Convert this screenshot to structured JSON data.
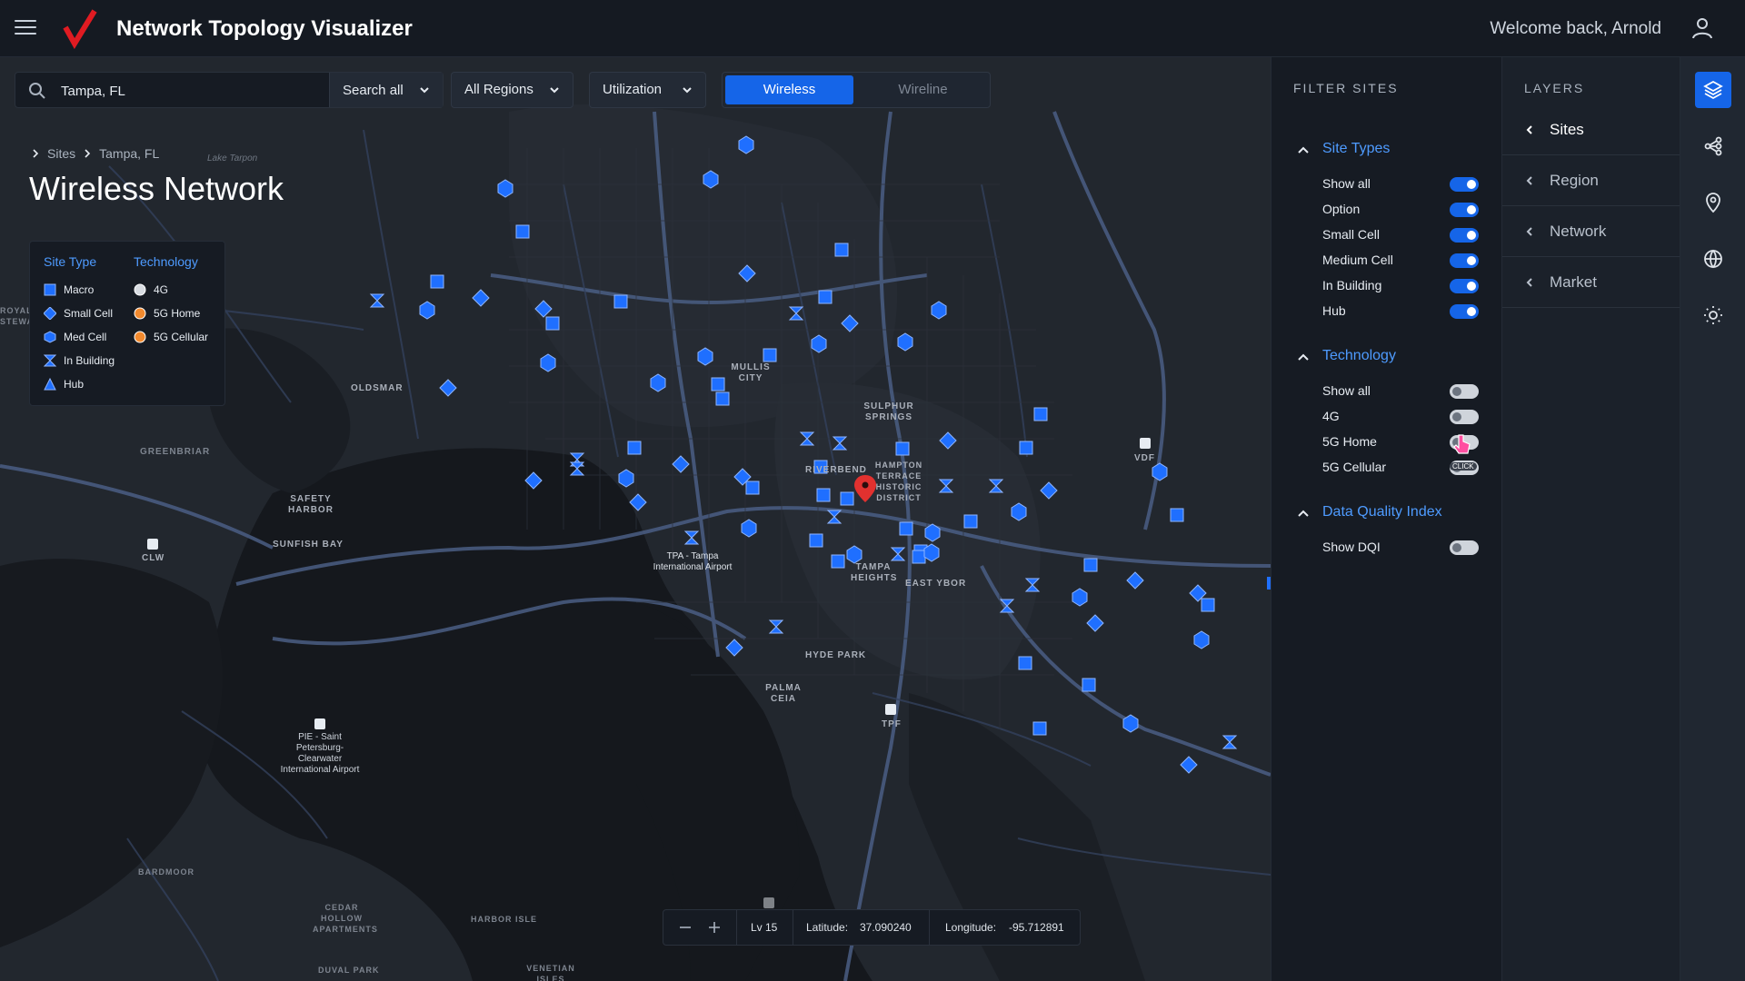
{
  "header": {
    "title": "Network Topology Visualizer",
    "welcome": "Welcome back, Arnold",
    "brand_color": "#e01b22"
  },
  "search": {
    "value": "Tampa, FL",
    "scope": "Search all"
  },
  "filters": {
    "region": "All Regions",
    "metric": "Utilization"
  },
  "network_toggle": {
    "options": [
      "Wireless",
      "Wireline"
    ],
    "selected": "Wireless"
  },
  "breadcrumb": [
    "Sites",
    "Tampa, FL"
  ],
  "page_title": "Wireless Network",
  "legend": {
    "site_type_title": "Site Type",
    "technology_title": "Technology",
    "site_types": [
      {
        "label": "Macro",
        "icon": "square-icon"
      },
      {
        "label": "Small Cell",
        "icon": "diamond-icon"
      },
      {
        "label": "Med Cell",
        "icon": "hexagon-icon"
      },
      {
        "label": "In Building",
        "icon": "hourglass-icon"
      },
      {
        "label": "Hub",
        "icon": "triangle-icon"
      }
    ],
    "technologies": [
      {
        "label": "4G",
        "color": "#d8dce2"
      },
      {
        "label": "5G Home",
        "color": "#f28a2e"
      },
      {
        "label": "5G Cellular",
        "color": "#f28a2e"
      }
    ]
  },
  "map_labels": {
    "lake_tarpon": "Lake Tarpon",
    "oldsmar": "OLDSMAR",
    "greenbriar": "GREENBRIAR",
    "safety_harbor": "SAFETY HARBOR",
    "sunfish_bay": "SUNFISH BAY",
    "clw": "CLW",
    "royal_stewart": "ROYAL STEWART",
    "mullis_city": "MULLIS CITY",
    "sulphur_springs": "SULPHUR SPRINGS",
    "riverbend": "RIVERBEND",
    "hampton": "HAMPTON TERRACE HISTORIC DISTRICT",
    "tpa": "TPA - Tampa International Airport",
    "tampa_heights": "TAMPA HEIGHTS",
    "east_ybor": "EAST YBOR",
    "hyde_park": "HYDE PARK",
    "palma_ceia": "PALMA CEIA",
    "tpf": "TPF",
    "vdf": "VDF",
    "pie": "PIE - Saint Petersburg-Clearwater International Airport",
    "bardmoor": "BARDMOOR",
    "cedar_hollow": "CEDAR HOLLOW APARTMENTS",
    "harbor_isle": "HARBOR ISLE",
    "duval_park": "DUVAL PARK",
    "venetian": "VENETIAN ISLES"
  },
  "status": {
    "level": "Lv 15",
    "latitude_label": "Latitude:",
    "latitude": "37.090240",
    "longitude_label": "Longitude:",
    "longitude": "-95.712891"
  },
  "filter_panel": {
    "heading": "FILTER SITES",
    "sections": [
      {
        "title": "Site Types",
        "rows": [
          {
            "label": "Show all",
            "on": true
          },
          {
            "label": "Option",
            "on": true
          },
          {
            "label": "Small Cell",
            "on": true
          },
          {
            "label": "Medium Cell",
            "on": true
          },
          {
            "label": "In Building",
            "on": true
          },
          {
            "label": "Hub",
            "on": true
          }
        ]
      },
      {
        "title": "Technology",
        "rows": [
          {
            "label": "Show all",
            "on": false
          },
          {
            "label": "4G",
            "on": false
          },
          {
            "label": "5G Home",
            "on": false
          },
          {
            "label": "5G Cellular",
            "on": false
          }
        ]
      },
      {
        "title": "Data Quality Index",
        "rows": [
          {
            "label": "Show DQI",
            "on": false
          }
        ]
      }
    ],
    "click_hint": "CLICK"
  },
  "layers_panel": {
    "heading": "LAYERS",
    "items": [
      "Sites",
      "Region",
      "Network",
      "Market"
    ],
    "active": "Sites"
  },
  "rail": {
    "icons": [
      "layers-icon",
      "share-nodes-icon",
      "location-pin-icon",
      "globe-icon",
      "sun-icon"
    ],
    "active": "layers-icon"
  },
  "sites": {
    "color": "#1f6fff"
  }
}
